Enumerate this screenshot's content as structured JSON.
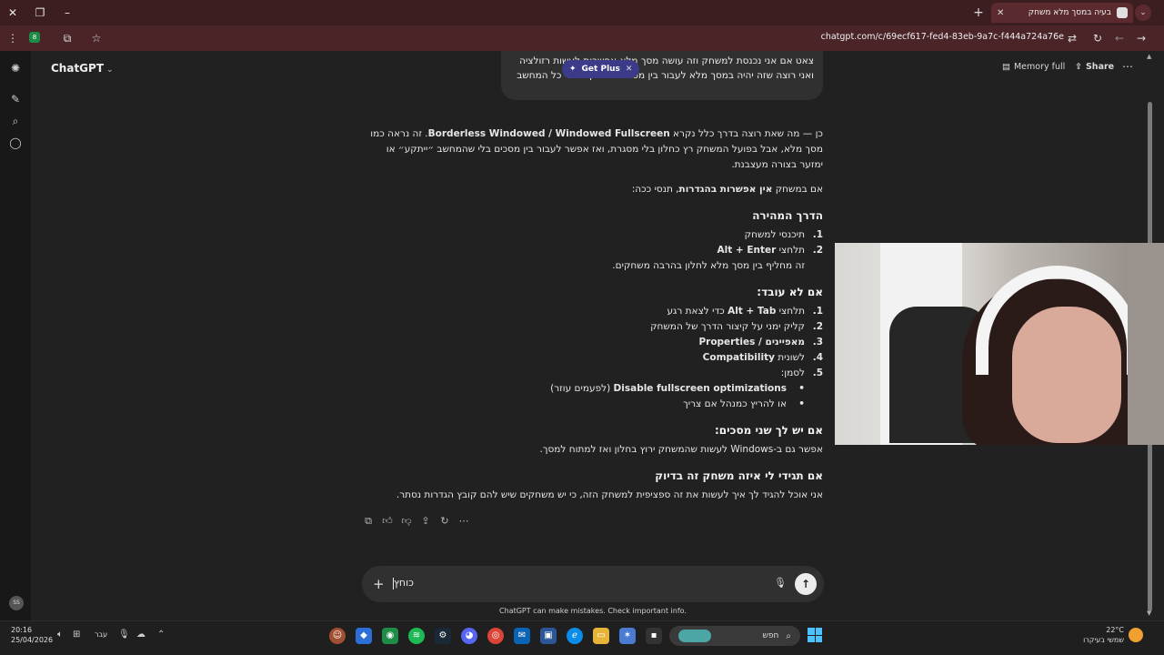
{
  "browser": {
    "tab_title": "בעיה במסך מלא משחק",
    "url": "chatgpt.com/c/69ecf617-fed4-83eb-9a7c-f444a724a76e",
    "extension_badge": "8"
  },
  "header": {
    "app_name": "ChatGPT",
    "memory_label": "Memory full",
    "share_label": "Share"
  },
  "promo": {
    "get_plus_label": "Get Plus"
  },
  "user_message": "צאט אם אני נכנסת למשחק וזה עושה מסך מלא אפשרות לעשות רזולציה ואני רוצה שזה יהיה במסך מלא לעבור בין מסכים ולא יקרוס לי כל המחשב",
  "answer": {
    "intro_prefix": "כן — מה שאת רוצה בדרך כלל נקרא ",
    "intro_bold": "Borderless Windowed / Windowed Fullscreen",
    "intro_suffix": ". זה נראה כמו מסך מלא, אבל בפועל המשחק רץ כחלון בלי מסגרת, ואז אפשר לעבור בין מסכים בלי שהמחשב ״ייתקע״ או ימזער בצורה מעצבנת.",
    "no_settings_prefix": "אם במשחק ",
    "no_settings_bold": "אין אפשרות בהגדרות",
    "no_settings_suffix": ", תנסי ככה:",
    "quick_heading": "הדרך המהירה",
    "quick_steps": [
      {
        "num": "1.",
        "text": "תיכנסי למשחק",
        "bold": ""
      },
      {
        "num": "2.",
        "text": "תלחצי ",
        "bold": "Alt + Enter",
        "sub": "זה מחליף בין מסך מלא לחלון בהרבה משחקים."
      }
    ],
    "not_working_heading": "אם לא עובד:",
    "not_working_steps": [
      {
        "num": "1.",
        "text_before": "תלחצי ",
        "bold": "Alt + Tab",
        "text_after": " כדי לצאת רגע"
      },
      {
        "num": "2.",
        "text_before": "קליק ימני על קיצור הדרך של המשחק",
        "bold": "",
        "text_after": ""
      },
      {
        "num": "3.",
        "text_before": "",
        "bold": "מאפיינים / Properties",
        "text_after": ""
      },
      {
        "num": "4.",
        "text_before": "לשונית ",
        "bold": "Compatibility",
        "text_after": ""
      },
      {
        "num": "5.",
        "text_before": "לסמן:",
        "bold": "",
        "text_after": ""
      }
    ],
    "bullets": [
      {
        "bold": "Disable fullscreen optimizations",
        "text": " (לפעמים עוזר)"
      },
      {
        "bold": "",
        "text": "או להריץ כמנהל אם צריך"
      }
    ],
    "two_screens_heading": "אם יש לך שני מסכים:",
    "two_screens_text": "אפשר גם ב-Windows לעשות שהמשחק ירוץ בחלון ואז למתוח למסך.",
    "tell_me_heading": "אם תגידי לי איזה משחק זה בדיוק",
    "tell_me_text": "אני אוכל להגיד לך איך לעשות את זה ספציפית למשחק הזה, כי יש משחקים שיש להם קובץ הגדרות נסתר."
  },
  "composer": {
    "input_value": "כוחץ",
    "disclaimer": "ChatGPT can make mistakes. Check important info."
  },
  "taskbar": {
    "time": "20:16",
    "date": "25/04/2026",
    "lang": "עבר",
    "search_placeholder": "חפש",
    "weather_temp": "22°C",
    "weather_desc": "שמשי בעיקרו"
  }
}
